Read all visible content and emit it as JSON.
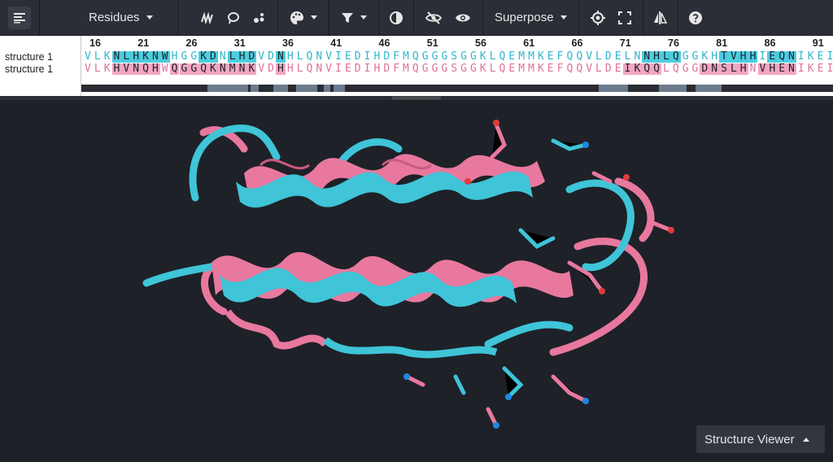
{
  "toolbar": {
    "residues_label": "Residues",
    "superpose_label": "Superpose"
  },
  "sequence": {
    "chains": [
      "structure 1",
      "structure 1"
    ],
    "ruler": [
      "16",
      "21",
      "26",
      "31",
      "36",
      "41",
      "46",
      "51",
      "56",
      "61",
      "66",
      "71",
      "76",
      "81",
      "86",
      "91"
    ],
    "row1": "VLKNLHKNWHGGKDNLHDVDNHLQNVIEDIHDFMQGGGSGGKLQEMMKEFQQVLDELNNHLQGGKHTVHHIEQNIKEI",
    "row2": "VLKHVNQHWQGGQKNMNKVDHHLQNVIEDIHDFMQGGGSGGKLQEMMKEFQQVLDEIKQQLQGGDNSLHNVHENIKEI"
  },
  "viewer": {
    "menu_label": "Structure Viewer"
  },
  "colors": {
    "cyan": "#3fc4d8",
    "pink": "#e8789e",
    "background": "#1e2128"
  }
}
